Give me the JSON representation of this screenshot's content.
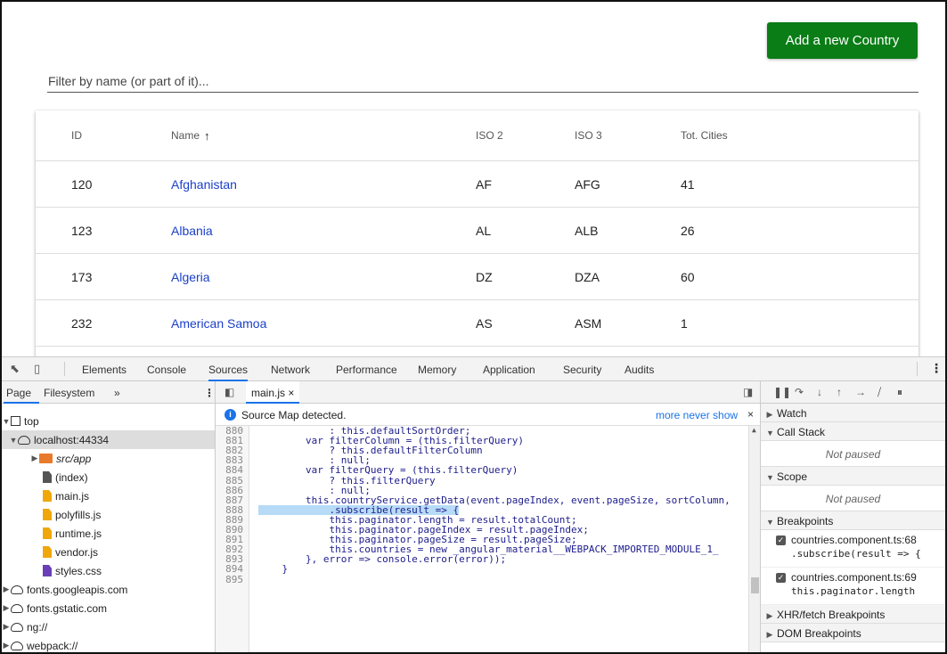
{
  "app": {
    "add_button": "Add a new Country",
    "filter_placeholder": "Filter by name (or part of it)...",
    "table": {
      "headers": {
        "id": "ID",
        "name": "Name",
        "iso2": "ISO 2",
        "iso3": "ISO 3",
        "cities": "Tot. Cities"
      },
      "sort_indicator": "↑",
      "rows": [
        {
          "id": "120",
          "name": "Afghanistan",
          "iso2": "AF",
          "iso3": "AFG",
          "cities": "41"
        },
        {
          "id": "123",
          "name": "Albania",
          "iso2": "AL",
          "iso3": "ALB",
          "cities": "26"
        },
        {
          "id": "173",
          "name": "Algeria",
          "iso2": "DZ",
          "iso3": "DZA",
          "cities": "60"
        },
        {
          "id": "232",
          "name": "American Samoa",
          "iso2": "AS",
          "iso3": "ASM",
          "cities": "1"
        }
      ]
    }
  },
  "devtools": {
    "tabs": [
      "Elements",
      "Console",
      "Sources",
      "Network",
      "Performance",
      "Memory",
      "Application",
      "Security",
      "Audits"
    ],
    "active_tab": "Sources",
    "navigator": {
      "tabs": [
        "Page",
        "Filesystem"
      ],
      "more": "»",
      "tree": [
        {
          "label": "top",
          "type": "frame",
          "expanded": true
        },
        {
          "label": "localhost:44334",
          "type": "origin",
          "expanded": true,
          "selected": true
        },
        {
          "label": "src/app",
          "type": "folder",
          "expanded": false
        },
        {
          "label": "(index)",
          "type": "file"
        },
        {
          "label": "main.js",
          "type": "js"
        },
        {
          "label": "polyfills.js",
          "type": "js"
        },
        {
          "label": "runtime.js",
          "type": "js"
        },
        {
          "label": "vendor.js",
          "type": "js"
        },
        {
          "label": "styles.css",
          "type": "css"
        },
        {
          "label": "fonts.googleapis.com",
          "type": "origin",
          "expanded": false
        },
        {
          "label": "fonts.gstatic.com",
          "type": "origin",
          "expanded": false
        },
        {
          "label": "ng://",
          "type": "origin",
          "expanded": false
        },
        {
          "label": "webpack://",
          "type": "origin",
          "expanded": false
        }
      ]
    },
    "editor": {
      "file_tab": "main.js",
      "close": "×",
      "source_map_message": "Source Map detected.",
      "source_map_actions": "more never show",
      "lines": [
        {
          "n": "880",
          "code": "            : this.defaultSortOrder;"
        },
        {
          "n": "881",
          "code": "        var filterColumn = (this.filterQuery)"
        },
        {
          "n": "882",
          "code": "            ? this.defaultFilterColumn"
        },
        {
          "n": "883",
          "code": "            : null;"
        },
        {
          "n": "884",
          "code": "        var filterQuery = (this.filterQuery)"
        },
        {
          "n": "885",
          "code": "            ? this.filterQuery"
        },
        {
          "n": "886",
          "code": "            : null;"
        },
        {
          "n": "887",
          "code": "        this.countryService.getData(event.pageIndex, event.pageSize, sortColumn,"
        },
        {
          "n": "888",
          "code": "            .subscribe(result => {",
          "highlight": true
        },
        {
          "n": "889",
          "code": "            this.paginator.length = result.totalCount;"
        },
        {
          "n": "890",
          "code": "            this.paginator.pageIndex = result.pageIndex;"
        },
        {
          "n": "891",
          "code": "            this.paginator.pageSize = result.pageSize;"
        },
        {
          "n": "892",
          "code": "            this.countries = new _angular_material__WEBPACK_IMPORTED_MODULE_1_"
        },
        {
          "n": "893",
          "code": "        }, error => console.error(error));"
        },
        {
          "n": "894",
          "code": "    }"
        },
        {
          "n": "895",
          "code": ""
        }
      ]
    },
    "debugger": {
      "watch": "Watch",
      "call_stack": "Call Stack",
      "call_stack_status": "Not paused",
      "scope": "Scope",
      "scope_status": "Not paused",
      "breakpoints": "Breakpoints",
      "breakpoint_items": [
        {
          "file": "countries.component.ts:68",
          "code": ".subscribe(result => {"
        },
        {
          "file": "countries.component.ts:69",
          "code": "this.paginator.length"
        }
      ],
      "xhr": "XHR/fetch Breakpoints",
      "dom": "DOM Breakpoints"
    }
  }
}
